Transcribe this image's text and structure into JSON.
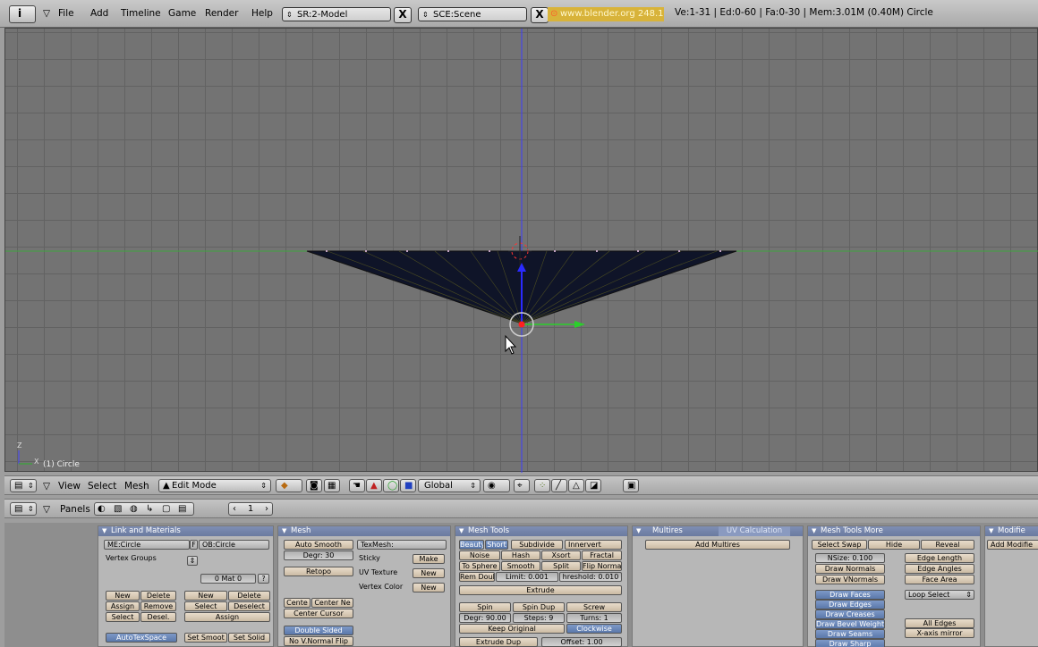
{
  "topbar": {
    "menus": [
      "File",
      "Add",
      "Timeline",
      "Game",
      "Render",
      "Help"
    ],
    "screen_field": "SR:2-Model",
    "scene_field": "SCE:Scene",
    "close_label": "X",
    "site": "www.blender.org 248.1",
    "stats": "Ve:1-31 | Ed:0-60 | Fa:0-30 | Mem:3.01M (0.40M) Circle"
  },
  "viewport": {
    "object_label": "(1) Circle",
    "axis_z": "Z",
    "axis_x": "X",
    "colors": {
      "background": "#737373",
      "grid": "#626262",
      "mesh": "#0f1428",
      "x_axis": "#3fa53f",
      "z_axis": "#3d3dff"
    }
  },
  "view3d_header": {
    "menus": [
      "View",
      "Select",
      "Mesh"
    ],
    "mode": "Edit Mode",
    "orientation": "Global"
  },
  "buttons_header": {
    "label": "Panels",
    "frame": "1"
  },
  "link_materials": {
    "title": "Link and Materials",
    "me_field": "ME:Circle",
    "f_label": "F",
    "ob_field": "OB:Circle",
    "vertex_groups": "Vertex Groups",
    "mat_field": "0 Mat 0",
    "question": "?",
    "vg_buttons": [
      "New",
      "Delete",
      "Assign",
      "Remove",
      "Select",
      "Desel."
    ],
    "mat_buttons": [
      "New",
      "Delete",
      "Select",
      "Deselect",
      "Assign"
    ],
    "autotex": "AutoTexSpace",
    "set_smooth": "Set Smoot",
    "set_solid": "Set Solid"
  },
  "mesh": {
    "title": "Mesh",
    "auto_smooth": "Auto Smooth",
    "degr": "Degr: 30",
    "retopo": "Retopo",
    "texmesh": "TexMesh:",
    "sticky": "Sticky",
    "make": "Make",
    "uv_texture": "UV Texture",
    "vertex_color": "Vertex Color",
    "new": "New",
    "center": "Cente",
    "center_new": "Center Ne",
    "center_cursor": "Center Cursor",
    "double_sided": "Double Sided",
    "no_v_normal_flip": "No V.Normal Flip"
  },
  "mesh_tools": {
    "title": "Mesh Tools",
    "row1": [
      "Beauty",
      "Short",
      "Subdivide",
      "Innervert"
    ],
    "row2": [
      "Noise",
      "Hash",
      "Xsort",
      "Fractal"
    ],
    "row3": [
      "To Sphere",
      "Smooth",
      "Split",
      "Flip Norma"
    ],
    "rem_doub": "Rem Doub",
    "limit": "Limit: 0.001",
    "threshold": "hreshold: 0.010",
    "extrude": "Extrude",
    "spin_row": [
      "Spin",
      "Spin Dup",
      "Screw"
    ],
    "degr": "Degr: 90.00",
    "steps": "Steps: 9",
    "turns": "Turns: 1",
    "keep_original": "Keep Original",
    "clockwise": "Clockwise",
    "extrude_dup": "Extrude Dup",
    "offset": "Offset: 1.00"
  },
  "multires": {
    "tab1": "Multires",
    "tab2": "UV Calculation",
    "add_multires": "Add Multires"
  },
  "mesh_tools_more": {
    "title": "Mesh Tools More",
    "row1": [
      "Select Swap",
      "Hide",
      "Reveal"
    ],
    "nsize": "NSize: 0.100",
    "draw_normals": "Draw Normals",
    "draw_vnormals": "Draw VNormals",
    "edge_length": "Edge Length",
    "edge_angles": "Edge Angles",
    "face_area": "Face Area",
    "draw_list": [
      "Draw Faces",
      "Draw Edges",
      "Draw Creases",
      "Draw Bevel Weights",
      "Draw Seams",
      "Draw Sharp"
    ],
    "loop_select": "Loop Select",
    "all_edges": "All Edges",
    "x_mirror": "X-axis mirror"
  },
  "modifiers": {
    "title": "Modifie",
    "add": "Add Modifie"
  }
}
